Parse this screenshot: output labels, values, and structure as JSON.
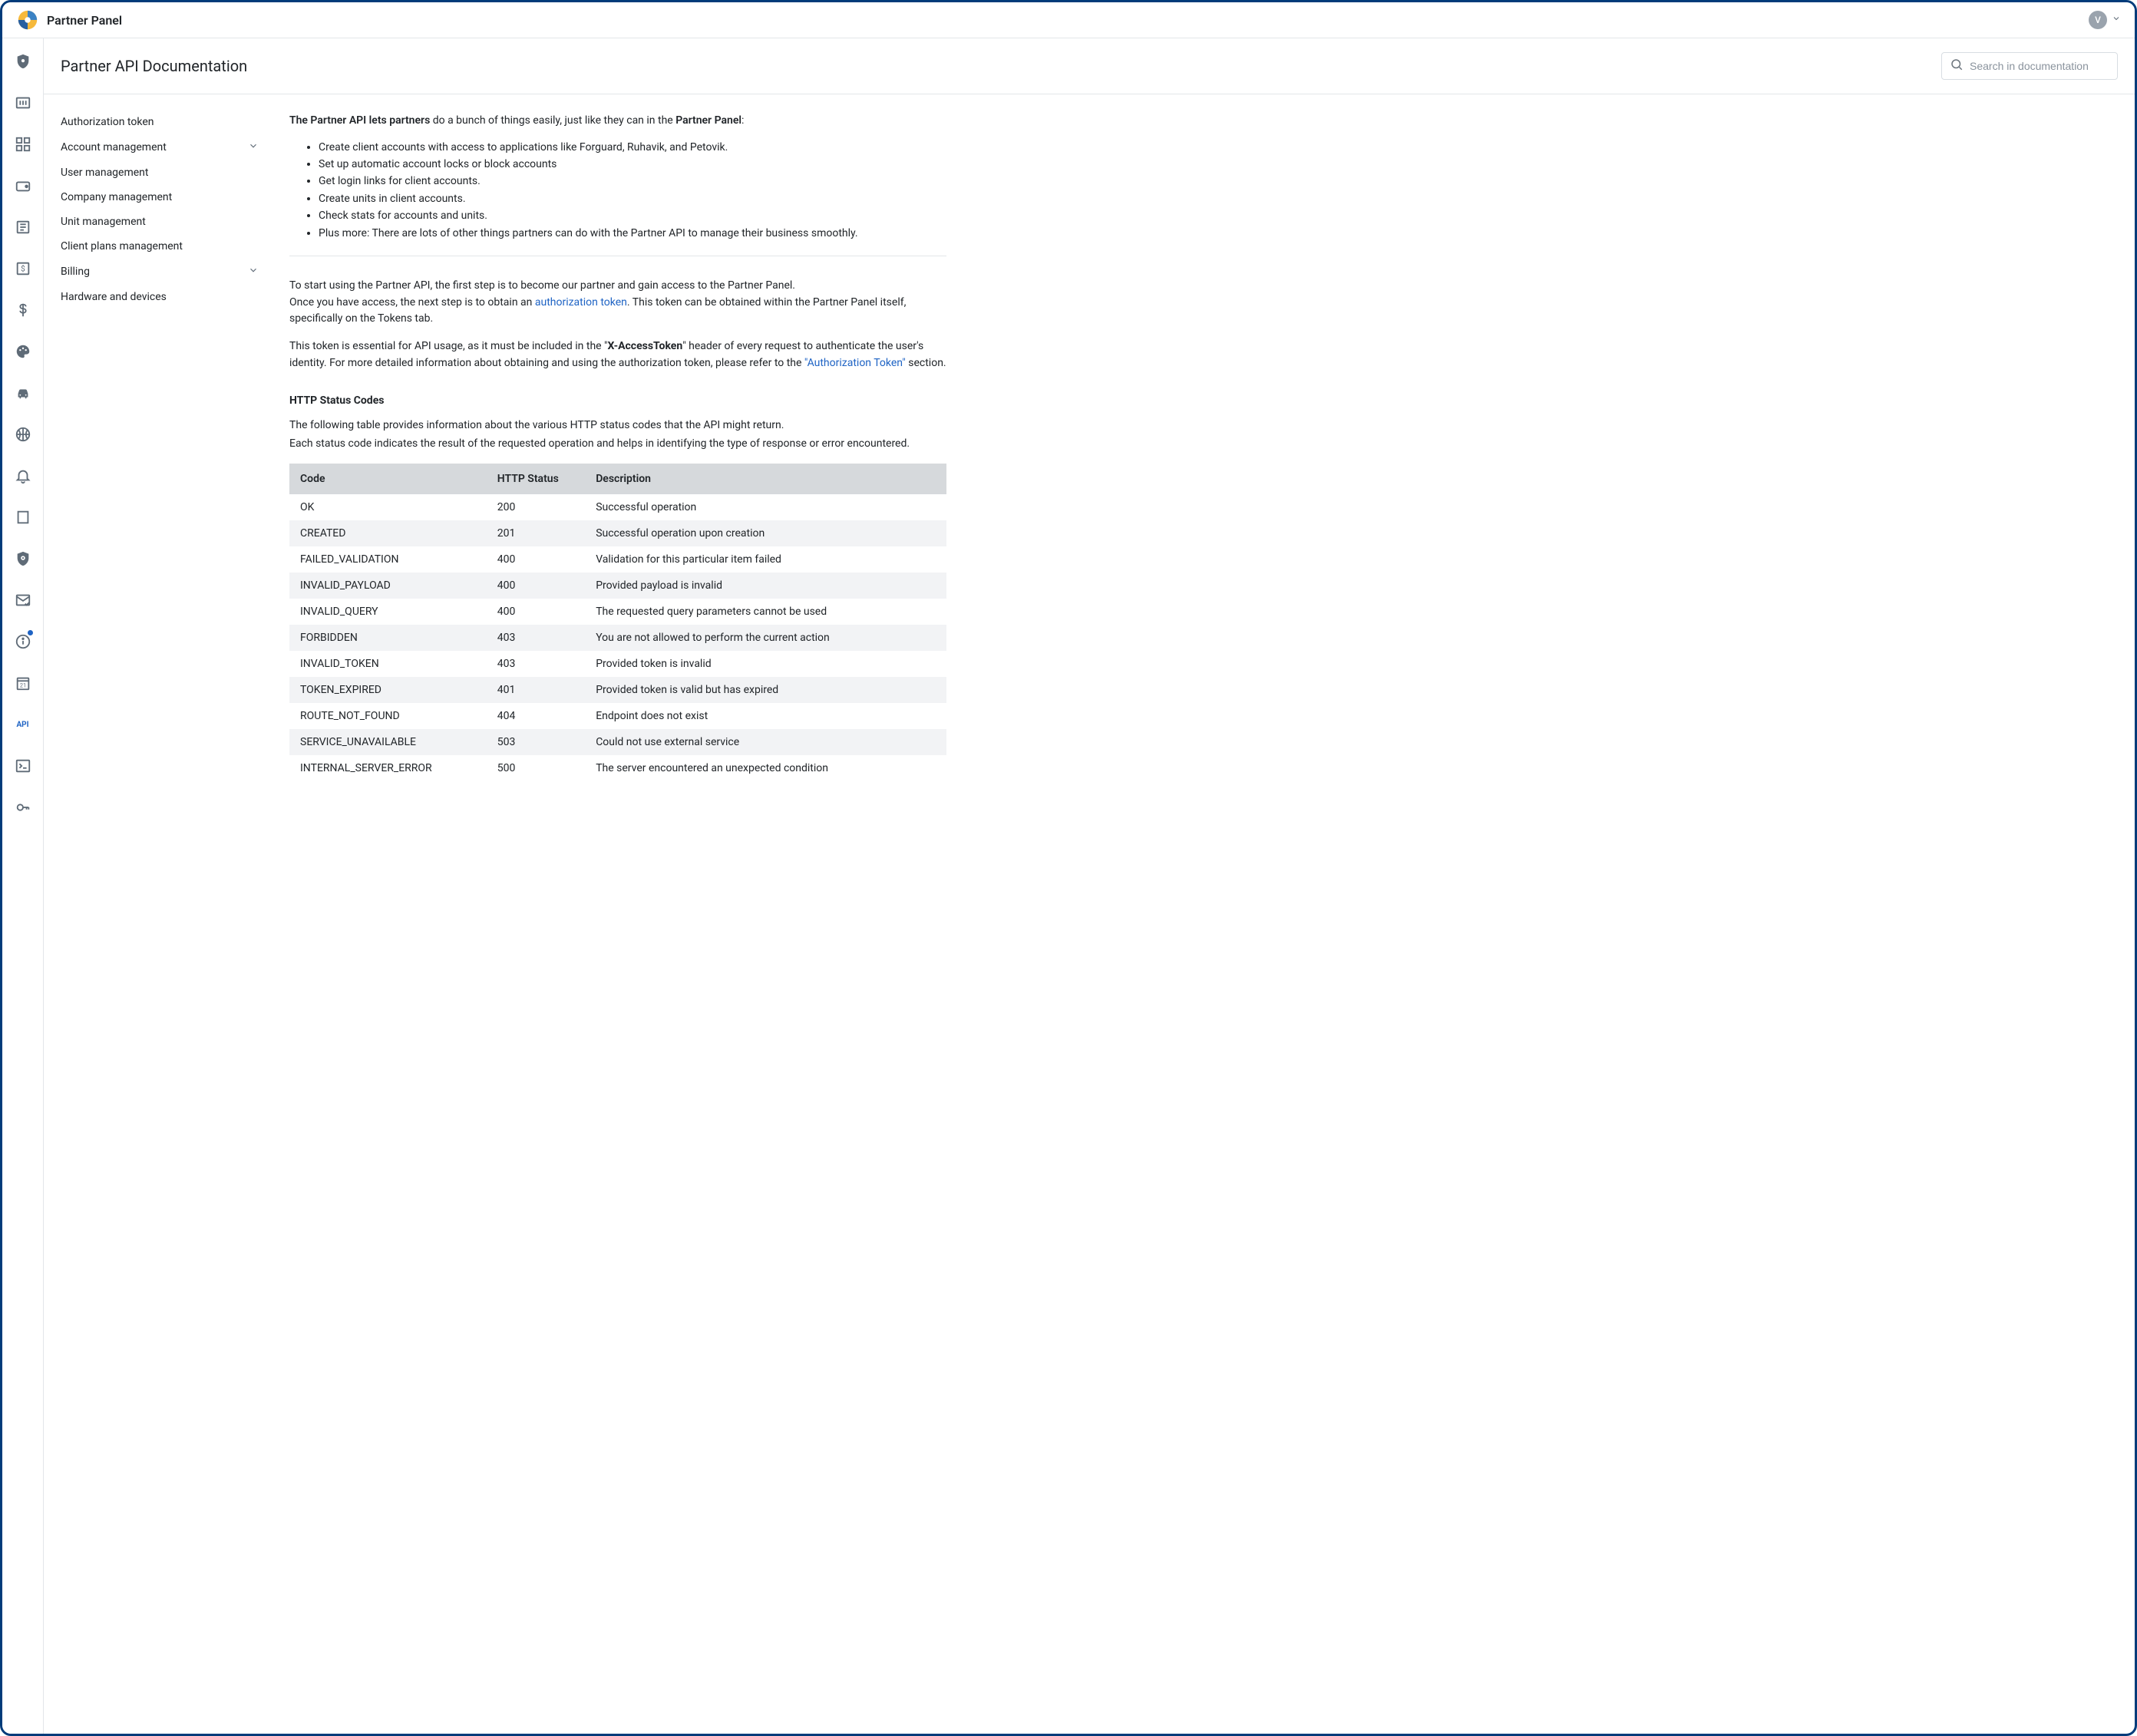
{
  "header": {
    "brand_title": "Partner Panel",
    "avatar_letter": "V"
  },
  "page": {
    "title": "Partner API Documentation",
    "search_placeholder": "Search in documentation"
  },
  "doc_nav": {
    "items": [
      {
        "label": "Authorization token",
        "expandable": false
      },
      {
        "label": "Account management",
        "expandable": true
      },
      {
        "label": "User management",
        "expandable": false
      },
      {
        "label": "Company management",
        "expandable": false
      },
      {
        "label": "Unit management",
        "expandable": false
      },
      {
        "label": "Client plans management",
        "expandable": false
      },
      {
        "label": "Billing",
        "expandable": true
      },
      {
        "label": "Hardware and devices",
        "expandable": false
      }
    ]
  },
  "intro": {
    "prefix_bold": "The Partner API lets partners",
    "middle": " do a bunch of things easily, just like they can in the ",
    "suffix_bold": "Partner Panel",
    "end": ":"
  },
  "bullets": [
    "Create client accounts with access to applications like Forguard, Ruhavik, and Petovik.",
    "Set up automatic account locks or block accounts",
    "Get login links for client accounts.",
    "Create units in client accounts.",
    "Check stats for accounts and units.",
    "Plus more: There are lots of other things partners can do with the Partner API to manage their business smoothly."
  ],
  "start": {
    "line1": "To start using the Partner API, the first step is to become our partner and gain access to the Partner Panel.",
    "line2_a": "Once you have access, the next step is to obtain an ",
    "line2_link": "authorization token",
    "line2_b": ". This token can be obtained within the Partner Panel itself, specifically on the Tokens tab."
  },
  "token_note": {
    "a": "This token is essential for API usage, as it must be included in the \"",
    "bold": "X-AccessToken",
    "b": "\" header of every request to authenticate the user's identity. For more detailed information about obtaining and using the authorization token, please refer to the ",
    "link": "\"Authorization Token\"",
    "c": " section."
  },
  "status_section": {
    "heading": "HTTP Status Codes",
    "desc1": "The following table provides information about the various HTTP status codes that the API might return.",
    "desc2": "Each status code indicates the result of the requested operation and helps in identifying the type of response or error encountered."
  },
  "status_table": {
    "headers": {
      "code": "Code",
      "http": "HTTP Status",
      "desc": "Description"
    },
    "rows": [
      {
        "code": "OK",
        "http": "200",
        "desc": "Successful operation"
      },
      {
        "code": "CREATED",
        "http": "201",
        "desc": "Successful operation upon creation"
      },
      {
        "code": "FAILED_VALIDATION",
        "http": "400",
        "desc": "Validation for this particular item failed"
      },
      {
        "code": "INVALID_PAYLOAD",
        "http": "400",
        "desc": "Provided payload is invalid"
      },
      {
        "code": "INVALID_QUERY",
        "http": "400",
        "desc": "The requested query parameters cannot be used"
      },
      {
        "code": "FORBIDDEN",
        "http": "403",
        "desc": "You are not allowed to perform the current action"
      },
      {
        "code": "INVALID_TOKEN",
        "http": "403",
        "desc": "Provided token is invalid"
      },
      {
        "code": "TOKEN_EXPIRED",
        "http": "401",
        "desc": "Provided token is valid but has expired"
      },
      {
        "code": "ROUTE_NOT_FOUND",
        "http": "404",
        "desc": "Endpoint does not exist"
      },
      {
        "code": "SERVICE_UNAVAILABLE",
        "http": "503",
        "desc": "Could not use external service"
      },
      {
        "code": "INTERNAL_SERVER_ERROR",
        "http": "500",
        "desc": "The server encountered an unexpected condition"
      }
    ]
  },
  "rail": {
    "api_label": "API"
  }
}
